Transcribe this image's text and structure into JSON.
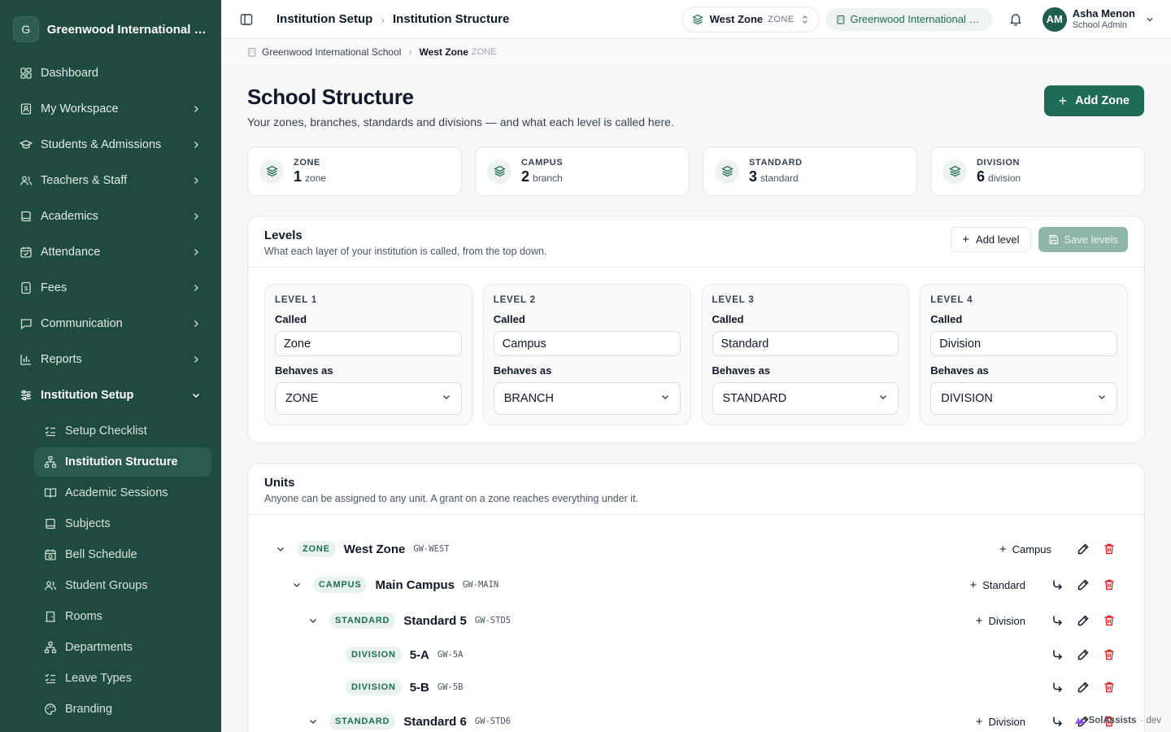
{
  "org": {
    "initial": "G",
    "name": "Greenwood International Sc..."
  },
  "nav": [
    {
      "label": "Dashboard",
      "icon": "dashboard-icon",
      "chevron": false
    },
    {
      "label": "My Workspace",
      "icon": "workspace-icon",
      "chevron": true
    },
    {
      "label": "Students & Admissions",
      "icon": "graduation-cap-icon",
      "chevron": true
    },
    {
      "label": "Teachers & Staff",
      "icon": "users-icon",
      "chevron": true
    },
    {
      "label": "Academics",
      "icon": "book-icon",
      "chevron": true
    },
    {
      "label": "Attendance",
      "icon": "calendar-check-icon",
      "chevron": true
    },
    {
      "label": "Fees",
      "icon": "receipt-icon",
      "chevron": true
    },
    {
      "label": "Communication",
      "icon": "chat-icon",
      "chevron": true
    },
    {
      "label": "Reports",
      "icon": "bar-chart-icon",
      "chevron": true
    },
    {
      "label": "Institution Setup",
      "icon": "sliders-icon",
      "chevron": "down"
    }
  ],
  "subnav": [
    {
      "label": "Setup Checklist",
      "icon": "checklist-icon",
      "active": false
    },
    {
      "label": "Institution Structure",
      "icon": "hierarchy-icon",
      "active": true
    },
    {
      "label": "Academic Sessions",
      "icon": "book-open-icon",
      "active": false
    },
    {
      "label": "Subjects",
      "icon": "book-icon",
      "active": false
    },
    {
      "label": "Bell Schedule",
      "icon": "calendar-clock-icon",
      "active": false
    },
    {
      "label": "Student Groups",
      "icon": "users-icon",
      "active": false
    },
    {
      "label": "Rooms",
      "icon": "door-icon",
      "active": false
    },
    {
      "label": "Departments",
      "icon": "hierarchy-icon",
      "active": false
    },
    {
      "label": "Leave Types",
      "icon": "checklist-icon",
      "active": false
    },
    {
      "label": "Branding",
      "icon": "palette-icon",
      "active": false
    }
  ],
  "topbar": {
    "crumb1": "Institution Setup",
    "crumb2": "Institution Structure",
    "zone_name": "West Zone",
    "zone_tag": "ZONE",
    "school": "Greenwood International S...",
    "user_initials": "AM",
    "user_name": "Asha Menon",
    "user_role": "School Admin"
  },
  "breadcrumb": {
    "school": "Greenwood International School",
    "current": "West Zone",
    "tag": "ZONE"
  },
  "page": {
    "title": "School Structure",
    "subtitle": "Your zones, branches, standards and divisions — and what each level is called here.",
    "add_zone": "Add Zone"
  },
  "stats": [
    {
      "label": "ZONE",
      "value": "1",
      "unit": "zone"
    },
    {
      "label": "CAMPUS",
      "value": "2",
      "unit": "branch"
    },
    {
      "label": "STANDARD",
      "value": "3",
      "unit": "standard"
    },
    {
      "label": "DIVISION",
      "value": "6",
      "unit": "division"
    }
  ],
  "levels": {
    "title": "Levels",
    "subtitle": "What each layer of your institution is called, from the top down.",
    "add_level": "Add level",
    "save_levels": "Save levels",
    "called_label": "Called",
    "behaves_label": "Behaves as",
    "items": [
      {
        "title": "LEVEL 1",
        "called": "Zone",
        "behaves": "ZONE"
      },
      {
        "title": "LEVEL 2",
        "called": "Campus",
        "behaves": "BRANCH"
      },
      {
        "title": "LEVEL 3",
        "called": "Standard",
        "behaves": "STANDARD"
      },
      {
        "title": "LEVEL 4",
        "called": "Division",
        "behaves": "DIVISION"
      }
    ]
  },
  "units": {
    "title": "Units",
    "subtitle": "Anyone can be assigned to any unit. A grant on a zone reaches everything under it.",
    "rows": [
      {
        "depth": 0,
        "expanded": true,
        "badge": "ZONE",
        "name": "West Zone",
        "code": "GW-WEST",
        "add": "Campus",
        "move": false
      },
      {
        "depth": 1,
        "expanded": true,
        "badge": "CAMPUS",
        "name": "Main Campus",
        "code": "GW-MAIN",
        "add": "Standard",
        "move": true
      },
      {
        "depth": 2,
        "expanded": true,
        "badge": "STANDARD",
        "name": "Standard 5",
        "code": "GW-STD5",
        "add": "Division",
        "move": true
      },
      {
        "depth": 3,
        "expanded": null,
        "badge": "DIVISION",
        "name": "5-A",
        "code": "GW-5A",
        "add": "",
        "move": true
      },
      {
        "depth": 3,
        "expanded": null,
        "badge": "DIVISION",
        "name": "5-B",
        "code": "GW-5B",
        "add": "",
        "move": true
      },
      {
        "depth": 2,
        "expanded": true,
        "badge": "STANDARD",
        "name": "Standard 6",
        "code": "GW-STD6",
        "add": "Division",
        "move": true
      }
    ]
  },
  "footer": {
    "brand": "SolAssists",
    "env": "· dev"
  },
  "colors": {
    "sidebar": "#1f4a3f",
    "accent": "#1f6b55",
    "danger": "#dc2626"
  }
}
